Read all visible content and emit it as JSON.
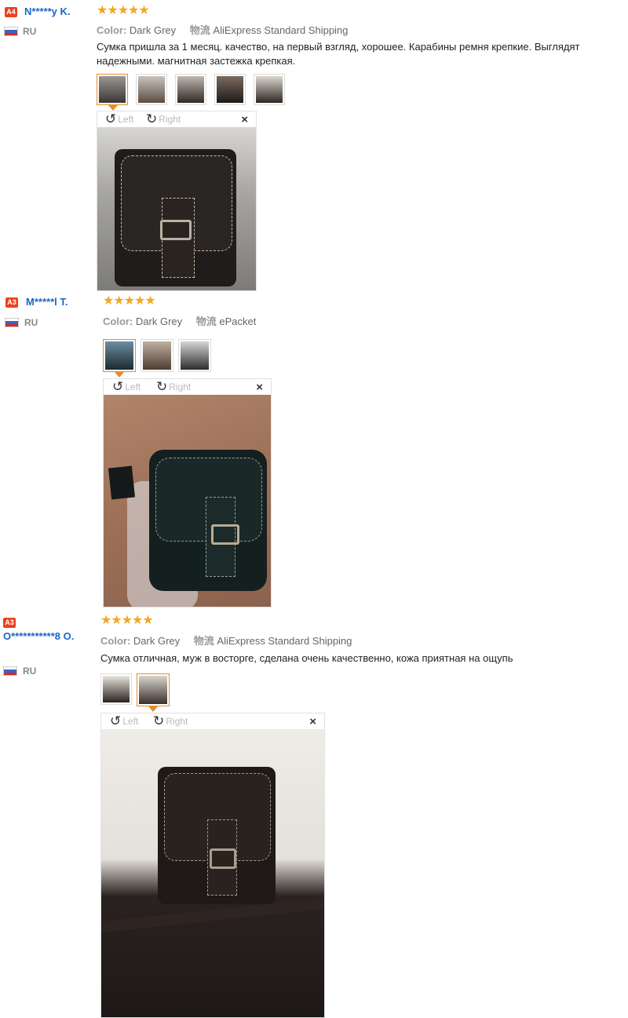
{
  "reviews": [
    {
      "level": "A4",
      "name": "N*****y K.",
      "country": "RU",
      "stars": "★★★★★",
      "color_key": "Color:",
      "color_val": "Dark Grey",
      "ship_key": "物流",
      "ship_val": "AliExpress Standard Shipping",
      "text": "Сумка пришла за 1 месяц. качество, на первый взгляд, хорошее. Карабины ремня крепкие. Выглядят надежными. магнитная застежка крепкая.",
      "left": "Left",
      "right": "Right",
      "close": "×",
      "colors": {
        "bg1": "#b8b5b0",
        "bg2": "#8c8a86",
        "bag": "#1c1a19"
      }
    },
    {
      "level": "A3",
      "name": "M*****l T.",
      "country": "RU",
      "stars": "★★★★★",
      "color_key": "Color:",
      "color_val": "Dark Grey",
      "ship_key": "物流",
      "ship_val": "ePacket",
      "text": "",
      "left": "Left",
      "right": "Right",
      "close": "×",
      "colors": {
        "bg1": "#a0735a",
        "bg2": "#8a5d48",
        "bag": "#15201f"
      }
    },
    {
      "level": "A3",
      "name": "O***********8 O.",
      "country": "RU",
      "stars": "★★★★★",
      "color_key": "Color:",
      "color_val": "Dark Grey",
      "ship_key": "物流",
      "ship_val": "AliExpress Standard Shipping",
      "text": "Сумка отличная, муж в восторге, сделана очень качественно, кожа приятная на ощупь",
      "left": "Left",
      "right": "Right",
      "close": "×",
      "colors": {
        "bg1": "#e8e4de",
        "bg2": "#5a4c44",
        "bag": "#1d1816"
      }
    }
  ]
}
